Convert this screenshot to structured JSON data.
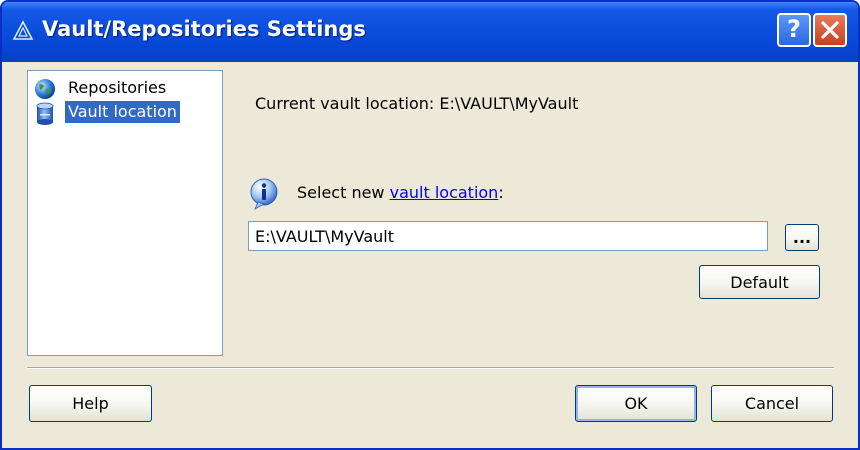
{
  "window": {
    "title": "Vault/Repositories Settings",
    "help_glyph": "?",
    "close_icon": "close-icon",
    "title_icon": "app-triangle-icon"
  },
  "tree": {
    "items": [
      {
        "label": "Repositories",
        "icon": "globe-icon",
        "selected": false
      },
      {
        "label": "Vault location",
        "icon": "vault-cylinder-icon",
        "selected": true
      }
    ]
  },
  "main": {
    "current_location": "Current vault location: E:\\VAULT\\MyVault",
    "select_prefix": "Select new ",
    "select_link": "vault location",
    "select_suffix": ":",
    "info_icon": "info-icon",
    "path_value": "E:\\VAULT\\MyVault",
    "browse_label": "...",
    "default_label": "Default"
  },
  "footer": {
    "help_label": "Help",
    "ok_label": "OK",
    "cancel_label": "Cancel"
  },
  "colors": {
    "titlebar": "#0a4fdd",
    "selection": "#316ac5",
    "link": "#0000ff",
    "dialog_bg": "#ece9d8"
  }
}
